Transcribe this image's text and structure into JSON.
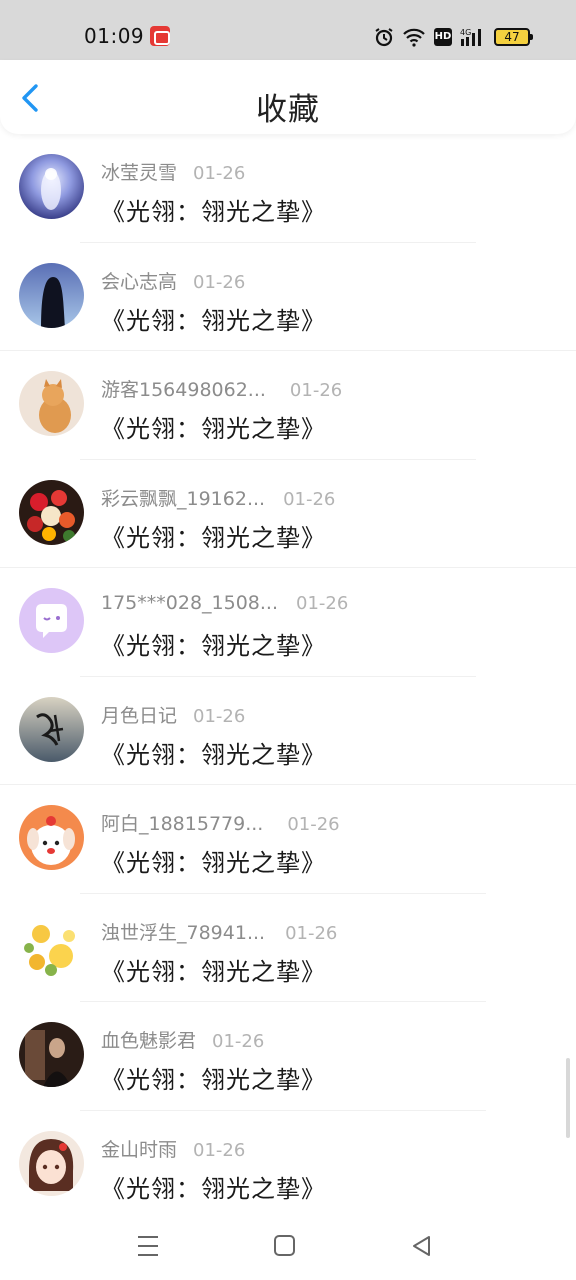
{
  "status_bar": {
    "time": "01:09",
    "battery": "47"
  },
  "header": {
    "title": "收藏"
  },
  "items": [
    {
      "user": "冰莹灵雪",
      "date": "01-26",
      "title": "《光翎：翎光之挚》",
      "avatar": "avatar-ice"
    },
    {
      "user": "会心志高",
      "date": "01-26",
      "title": "《光翎：翎光之挚》",
      "avatar": "avatar-girl-dark"
    },
    {
      "user": "游客156498062...",
      "date": "01-26",
      "title": "《光翎：翎光之挚》",
      "avatar": "avatar-cat"
    },
    {
      "user": "彩云飘飘_19162...",
      "date": "01-26",
      "title": "《光翎：翎光之挚》",
      "avatar": "avatar-flowers"
    },
    {
      "user": "175***028_1508...",
      "date": "01-26",
      "title": "《光翎：翎光之挚》",
      "avatar": "avatar-default-chat"
    },
    {
      "user": "月色日记",
      "date": "01-26",
      "title": "《光翎：翎光之挚》",
      "avatar": "avatar-calligraphy"
    },
    {
      "user": "阿白_18815779...",
      "date": "01-26",
      "title": "《光翎：翎光之挚》",
      "avatar": "avatar-dog-cartoon"
    },
    {
      "user": "浊世浮生_78941...",
      "date": "01-26",
      "title": "《光翎：翎光之挚》",
      "avatar": "avatar-yellow-flowers"
    },
    {
      "user": "血色魅影君",
      "date": "01-26",
      "title": "《光翎：翎光之挚》",
      "avatar": "avatar-dark-figure"
    },
    {
      "user": "金山时雨",
      "date": "01-26",
      "title": "《光翎：翎光之挚》",
      "avatar": "avatar-anime-girl"
    }
  ],
  "colors": {
    "accent": "#2196f3",
    "status_bar_bg": "#d9d9d9"
  }
}
